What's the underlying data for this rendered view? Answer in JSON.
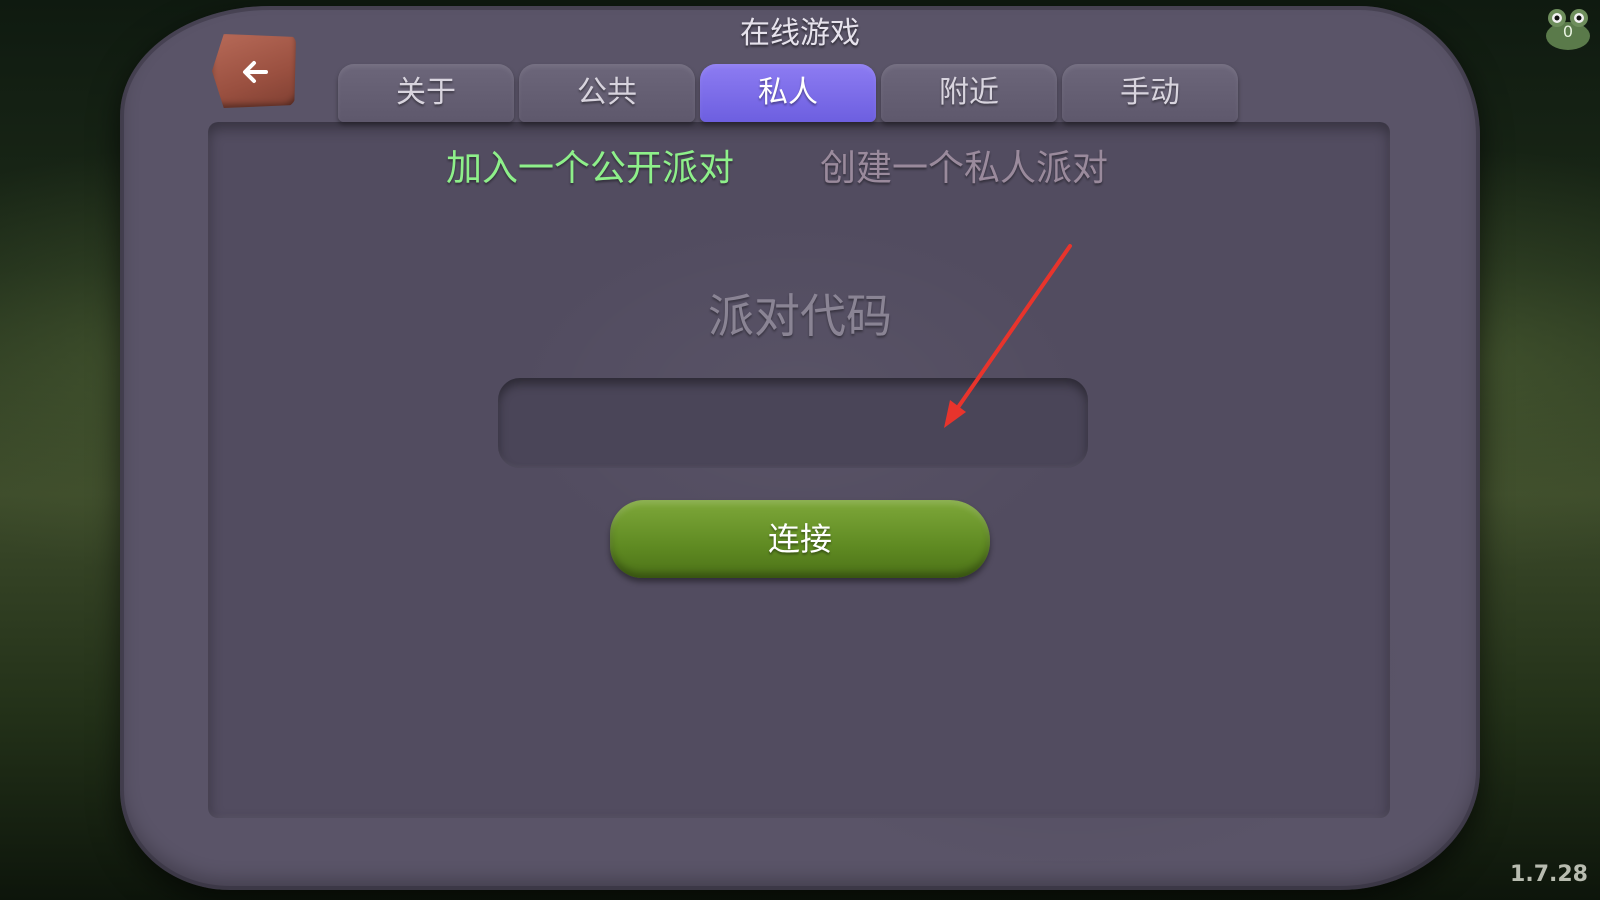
{
  "screen": {
    "title": "在线游戏"
  },
  "back_button": {
    "icon": "arrow-left-icon"
  },
  "tabs": [
    {
      "label": "关于",
      "active": false
    },
    {
      "label": "公共",
      "active": false
    },
    {
      "label": "私人",
      "active": true
    },
    {
      "label": "附近",
      "active": false
    },
    {
      "label": "手动",
      "active": false
    }
  ],
  "subtabs": {
    "join": "加入一个公开派对",
    "create": "创建一个私人派对"
  },
  "party_code": {
    "label": "派对代码",
    "value": ""
  },
  "connect_button": {
    "label": "连接"
  },
  "mascot": {
    "icon": "frog-mascot-icon",
    "count": "0"
  },
  "version": "1.7.28",
  "colors": {
    "active_tab": "#7b6cf0",
    "selected_subtab": "#8ef08a",
    "unselected_subtab": "#9a8a9c",
    "connect_button": "#6a9228",
    "back_button": "#a65a4a",
    "board": "#5a5468",
    "annotation_arrow": "#e8342c"
  }
}
